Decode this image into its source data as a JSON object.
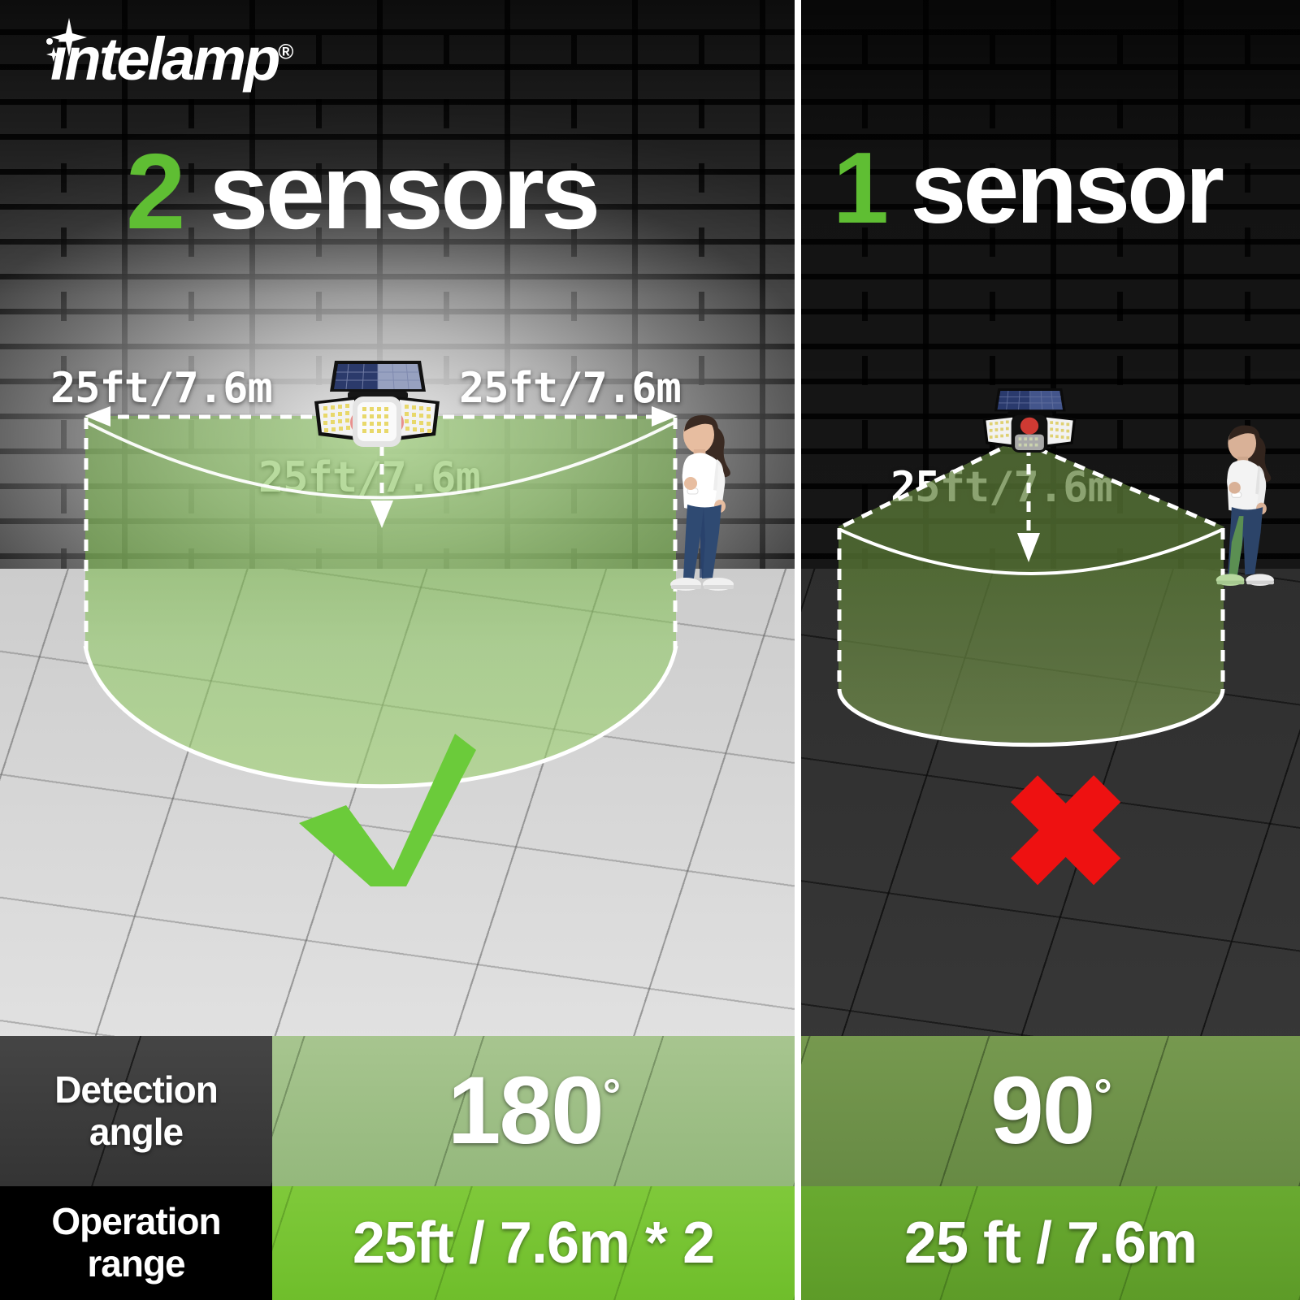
{
  "brand": {
    "logo_text": "intelamp",
    "registered_mark": "®",
    "sparkle_icon": "sparkle-icon"
  },
  "colors": {
    "brand_green": "#5FBE33",
    "check_green": "#6BCB3A",
    "cross_red": "#EE1111",
    "zone_fill_left": "#8CC95E",
    "zone_fill_right": "#6E8E46",
    "white": "#FFFFFF",
    "row_left_angle_bg": "#9CBE84",
    "row_right_angle_bg": "#6E9149",
    "row_left_range_bg": "#76C430",
    "row_right_range_bg": "#63A32C",
    "label_angle_bg": "#3B3B3B",
    "label_range_bg": "#000000"
  },
  "panels": {
    "left": {
      "headline_number": "2",
      "headline_word": "sensors",
      "verdict_icon": "check-icon",
      "lamp_icon": "solar-lamp-3-head-icon",
      "person_icon": "walking-woman-icon",
      "labels": {
        "left_range": "25ft/7.6m",
        "right_range": "25ft/7.6m",
        "center_range": "25ft/7.6m"
      }
    },
    "right": {
      "headline_number": "1",
      "headline_word": "sensor",
      "verdict_icon": "cross-icon",
      "lamp_icon": "solar-lamp-3-head-icon",
      "person_icon": "walking-woman-icon",
      "labels": {
        "center_range": "25ft/7.6m"
      }
    }
  },
  "comparison_table": {
    "rows": [
      {
        "label": "Detection\nangle",
        "label_line1": "Detection",
        "label_line2": "angle",
        "left_value": "180",
        "left_unit": "°",
        "right_value": "90",
        "right_unit": "°"
      },
      {
        "label": "Operation\nrange",
        "label_line1": "Operation",
        "label_line2": "range",
        "left_value": "25ft / 7.6m * 2",
        "right_value": "25 ft / 7.6m"
      }
    ]
  }
}
